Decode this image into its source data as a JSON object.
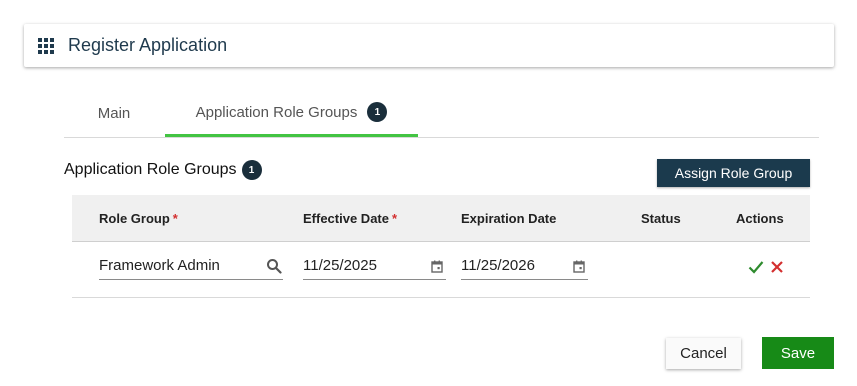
{
  "header": {
    "title": "Register Application",
    "icon": "apps-grid-icon"
  },
  "tabs": [
    {
      "label": "Main",
      "active": false
    },
    {
      "label": "Application Role Groups",
      "active": true,
      "badge": "1"
    }
  ],
  "section": {
    "title": "Application Role Groups",
    "count": "1",
    "assign_label": "Assign Role Group"
  },
  "table": {
    "columns": [
      {
        "label": "Role Group",
        "required": "*"
      },
      {
        "label": "Effective Date",
        "required": "*"
      },
      {
        "label": "Expiration Date"
      },
      {
        "label": "Status"
      },
      {
        "label": "Actions"
      }
    ],
    "rows": [
      {
        "role_group": "Framework Admin",
        "effective_date": "11/25/2025",
        "expiration_date": "11/25/2026",
        "status": ""
      }
    ]
  },
  "footer": {
    "cancel_label": "Cancel",
    "save_label": "Save"
  },
  "colors": {
    "accent_tab": "#43c443",
    "primary_dark": "#1b3a4d",
    "save_green": "#178a17",
    "required_red": "#d32f2f",
    "confirm_green": "#2e8b2e",
    "discard_red": "#d32f2f"
  }
}
